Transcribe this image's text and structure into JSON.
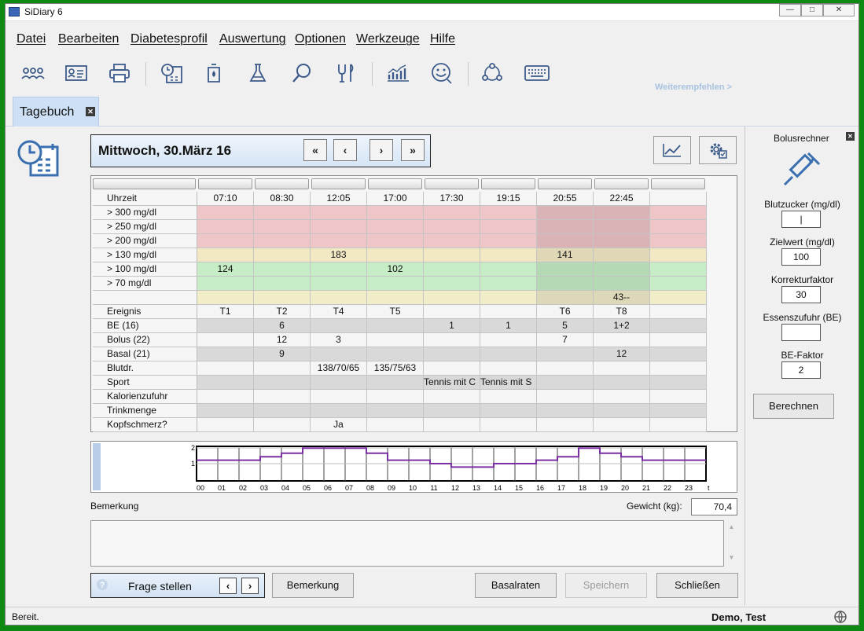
{
  "window": {
    "title": "SiDiary 6",
    "controls": [
      "—",
      "□",
      "✕"
    ]
  },
  "menu": [
    {
      "label": "Datei"
    },
    {
      "label": "Bearbeiten"
    },
    {
      "label": "Diabetesprofil"
    },
    {
      "label": "Auswertung"
    },
    {
      "label": "Optionen"
    },
    {
      "label": "Werkzeuge"
    },
    {
      "label": "Hilfe"
    }
  ],
  "toolbar": {
    "icons": [
      "users-icon",
      "id-card-icon",
      "printer-icon",
      "diary-calendar-icon",
      "blood-drop-device-icon",
      "flask-icon",
      "search-icon",
      "fork-glass-icon",
      "bar-chart-icon",
      "smiley-icon",
      "network-icon",
      "keyboard-icon"
    ],
    "recommend": "Weiterempfehlen >"
  },
  "tab": {
    "label": "Tagebuch",
    "close": "✕"
  },
  "datebar": {
    "date": "Mittwoch, 30.März 16",
    "nav": [
      "«",
      "‹",
      "›",
      "»"
    ]
  },
  "grid": {
    "times": [
      "07:10",
      "08:30",
      "12:05",
      "17:00",
      "17:30",
      "19:15",
      "20:55",
      "22:45",
      ""
    ],
    "rows": [
      {
        "label": "Uhrzeit",
        "kind": "time"
      },
      {
        "label": "> 300 mg/dl",
        "kind": "red"
      },
      {
        "label": "> 250 mg/dl",
        "kind": "red"
      },
      {
        "label": "> 200 mg/dl",
        "kind": "red"
      },
      {
        "label": "> 130 mg/dl",
        "kind": "yellow",
        "values": [
          "",
          "",
          "183",
          "",
          "",
          "",
          "141",
          "",
          ""
        ]
      },
      {
        "label": "> 100 mg/dl",
        "kind": "green",
        "values": [
          "124",
          "",
          "",
          "102",
          "",
          "",
          "",
          "",
          ""
        ]
      },
      {
        "label": ">   70 mg/dl",
        "kind": "green"
      },
      {
        "label": "",
        "kind": "lowyellow",
        "values": [
          "",
          "",
          "",
          "",
          "",
          "",
          "",
          "43--",
          ""
        ]
      },
      {
        "label": "Ereignis",
        "kind": "plain",
        "values": [
          "T1",
          "T2",
          "T4",
          "T5",
          "",
          "",
          "T6",
          "T8",
          ""
        ]
      },
      {
        "label": "BE (16)",
        "kind": "grey",
        "values": [
          "",
          "6",
          "",
          "",
          "1",
          "1",
          "5",
          "1+2",
          ""
        ]
      },
      {
        "label": "Bolus (22)",
        "kind": "plain",
        "values": [
          "",
          "12",
          "3",
          "",
          "",
          "",
          "7",
          "",
          ""
        ]
      },
      {
        "label": "Basal (21)",
        "kind": "grey",
        "values": [
          "",
          "9",
          "",
          "",
          "",
          "",
          "",
          "12",
          ""
        ]
      },
      {
        "label": "Blutdr.",
        "kind": "plain",
        "values": [
          "",
          "",
          "138/70/65",
          "135/75/63",
          "",
          "",
          "",
          "",
          ""
        ]
      },
      {
        "label": "Sport",
        "kind": "grey",
        "values": [
          "",
          "",
          "",
          "",
          "Tennis mit C",
          "Tennis mit S",
          "",
          "",
          ""
        ]
      },
      {
        "label": "Kalorienzufuhr",
        "kind": "plain"
      },
      {
        "label": "Trinkmenge",
        "kind": "grey"
      },
      {
        "label": "Kopfschmerz?",
        "kind": "plain",
        "values": [
          "",
          "",
          "Ja",
          "",
          "",
          "",
          "",
          "",
          ""
        ]
      }
    ]
  },
  "basal_chart": {
    "y_ticks": [
      "2",
      "1"
    ],
    "hours": [
      "00",
      "01",
      "02",
      "03",
      "04",
      "05",
      "06",
      "07",
      "08",
      "09",
      "10",
      "11",
      "12",
      "13",
      "14",
      "15",
      "16",
      "17",
      "18",
      "19",
      "20",
      "21",
      "22",
      "23"
    ],
    "x_unit": "t",
    "rates": [
      1.2,
      1.2,
      1.2,
      1.4,
      1.6,
      1.9,
      1.9,
      1.9,
      1.6,
      1.2,
      1.2,
      1.0,
      0.8,
      0.8,
      1.0,
      1.0,
      1.2,
      1.4,
      1.9,
      1.6,
      1.4,
      1.2,
      1.2,
      1.2
    ]
  },
  "remark": {
    "label": "Bemerkung",
    "text": ""
  },
  "weight": {
    "label": "Gewicht (kg):",
    "value": "70,4"
  },
  "ask": {
    "label": "Frage stellen",
    "prev": "‹",
    "next": "›"
  },
  "buttons": {
    "remark": "Bemerkung",
    "basal_rates": "Basalraten",
    "save": "Speichern",
    "close": "Schließen"
  },
  "status": {
    "text": "Bereit.",
    "user": "Demo, Test"
  },
  "bolus": {
    "title": "Bolusrechner",
    "fields": [
      {
        "label": "Blutzucker (mg/dl)",
        "value": "|"
      },
      {
        "label": "Zielwert (mg/dl)",
        "value": "100"
      },
      {
        "label": "Korrekturfaktor",
        "value": "30"
      },
      {
        "label": "Essenszufuhr (BE)",
        "value": ""
      },
      {
        "label": "BE-Faktor",
        "value": "2"
      }
    ],
    "calc_button": "Berechnen"
  },
  "colors": {
    "red": "#eec6c8",
    "red_dark": "#d9b3b5",
    "yellow": "#f2e9c4",
    "yellow_dark": "#dfd7b5",
    "green": "#c7edc6",
    "green_dark": "#b5d8b5",
    "grey": "#d9d9d9",
    "plain": "#f5f5f5",
    "lowyellow": "#f1edc9",
    "lowyellow_dark": "#ddd9b8",
    "basal_line": "#7a2fa5"
  }
}
